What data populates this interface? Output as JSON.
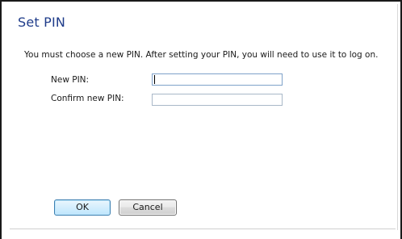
{
  "dialog": {
    "title": "Set PIN",
    "instructions": "You must choose a new PIN. After setting your PIN, you will need to use it to log on."
  },
  "form": {
    "new_pin": {
      "label": "New PIN:",
      "value": ""
    },
    "confirm_pin": {
      "label": "Confirm new PIN:",
      "value": ""
    }
  },
  "buttons": {
    "ok_label": "OK",
    "cancel_label": "Cancel"
  },
  "colors": {
    "title": "#1f3c8a",
    "ok_border": "#3c7fb1",
    "cancel_border": "#707070"
  }
}
